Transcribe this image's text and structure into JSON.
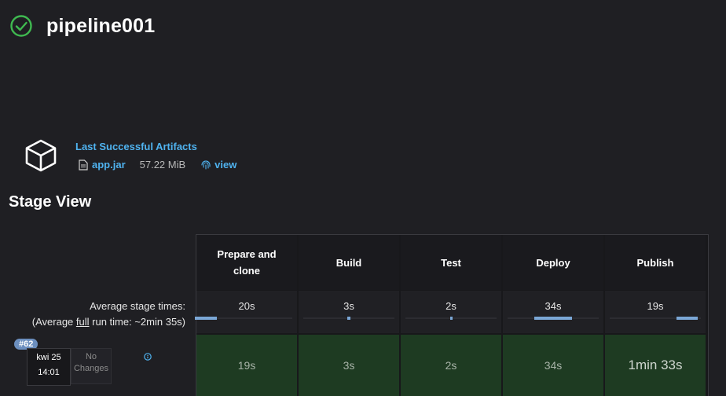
{
  "header": {
    "title": "pipeline001",
    "status_icon": "check-circle-icon",
    "status_color": "#3fb950"
  },
  "artifacts": {
    "title": "Last Successful Artifacts",
    "file_name": "app.jar",
    "file_size": "57.22 MiB",
    "view_label": "view"
  },
  "stage_view": {
    "title": "Stage View",
    "avg_label_line1": "Average stage times:",
    "avg_label_prefix": "(Average ",
    "avg_label_full": "full",
    "avg_label_suffix": " run time: ~2min 35s)",
    "stages": [
      {
        "name": "Prepare and clone",
        "avg": "20s",
        "avg_fraction": 0.59,
        "duration": "19s"
      },
      {
        "name": "Build",
        "avg": "3s",
        "avg_fraction": 0.09,
        "duration": "3s"
      },
      {
        "name": "Test",
        "avg": "2s",
        "avg_fraction": 0.06,
        "duration": "2s"
      },
      {
        "name": "Deploy",
        "avg": "34s",
        "avg_fraction": 1.0,
        "duration": "34s"
      },
      {
        "name": "Publish",
        "avg": "19s",
        "avg_fraction": 0.56,
        "duration": "1min 33s"
      }
    ],
    "bar_color": "#7ba7d6",
    "success_color": "#1e3b22"
  },
  "build": {
    "number": "#62",
    "date": "kwi 25",
    "time": "14:01",
    "changes": "No Changes"
  }
}
